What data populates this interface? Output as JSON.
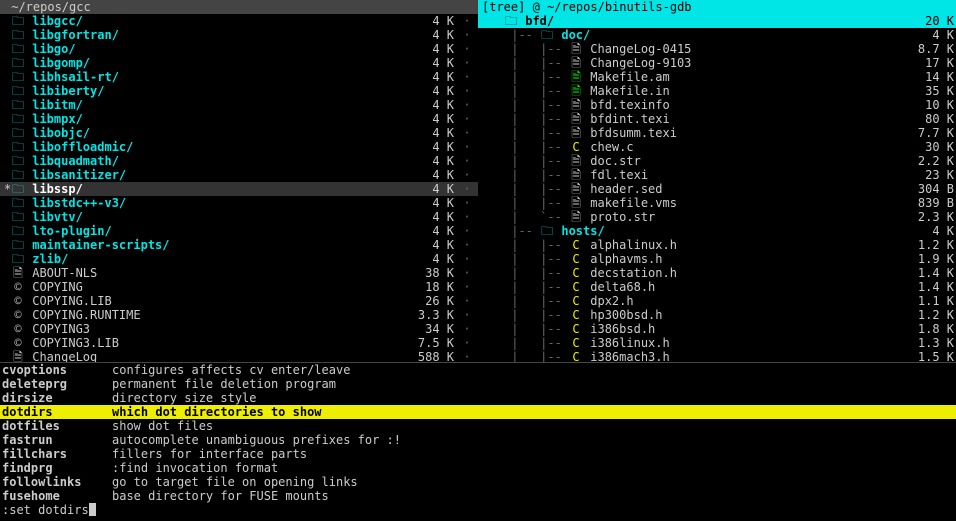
{
  "left": {
    "title": " ~/repos/gcc",
    "items": [
      {
        "icon": "dir",
        "name": "libgcc/",
        "size": "4 K",
        "type": "dir"
      },
      {
        "icon": "dir",
        "name": "libgfortran/",
        "size": "4 K",
        "type": "dir"
      },
      {
        "icon": "dir",
        "name": "libgo/",
        "size": "4 K",
        "type": "dir"
      },
      {
        "icon": "dir",
        "name": "libgomp/",
        "size": "4 K",
        "type": "dir"
      },
      {
        "icon": "dir",
        "name": "libhsail-rt/",
        "size": "4 K",
        "type": "dir"
      },
      {
        "icon": "dir",
        "name": "libiberty/",
        "size": "4 K",
        "type": "dir"
      },
      {
        "icon": "dir",
        "name": "libitm/",
        "size": "4 K",
        "type": "dir"
      },
      {
        "icon": "dir",
        "name": "libmpx/",
        "size": "4 K",
        "type": "dir"
      },
      {
        "icon": "dir",
        "name": "libobjc/",
        "size": "4 K",
        "type": "dir"
      },
      {
        "icon": "dir",
        "name": "liboffloadmic/",
        "size": "4 K",
        "type": "dir"
      },
      {
        "icon": "dir",
        "name": "libquadmath/",
        "size": "4 K",
        "type": "dir"
      },
      {
        "icon": "dir",
        "name": "libsanitizer/",
        "size": "4 K",
        "type": "dir"
      },
      {
        "icon": "dir",
        "name": "libssp/",
        "size": "4 K",
        "type": "dir",
        "sel": true,
        "star": "*"
      },
      {
        "icon": "dir",
        "name": "libstdc++-v3/",
        "size": "4 K",
        "type": "dir"
      },
      {
        "icon": "dir",
        "name": "libvtv/",
        "size": "4 K",
        "type": "dir"
      },
      {
        "icon": "dir",
        "name": "lto-plugin/",
        "size": "4 K",
        "type": "dir"
      },
      {
        "icon": "dir",
        "name": "maintainer-scripts/",
        "size": "4 K",
        "type": "dir"
      },
      {
        "icon": "dir",
        "name": "zlib/",
        "size": "4 K",
        "type": "dir"
      },
      {
        "icon": "txt",
        "name": "ABOUT-NLS",
        "size": "38 K",
        "type": "file"
      },
      {
        "icon": "lic",
        "name": "COPYING",
        "size": "18 K",
        "type": "file"
      },
      {
        "icon": "lic",
        "name": "COPYING.LIB",
        "size": "26 K",
        "type": "file"
      },
      {
        "icon": "lic",
        "name": "COPYING.RUNTIME",
        "size": "3.3 K",
        "type": "file"
      },
      {
        "icon": "lic",
        "name": "COPYING3",
        "size": "34 K",
        "type": "file"
      },
      {
        "icon": "lic",
        "name": "COPYING3.LIB",
        "size": "7.5 K",
        "type": "file"
      },
      {
        "icon": "txt",
        "name": "ChangeLog",
        "size": "588 K",
        "type": "file"
      }
    ]
  },
  "right": {
    "title": "[tree] @ ~/repos/binutils-gdb",
    "items": [
      {
        "tree": "",
        "icon": "dir",
        "name": "bfd/",
        "size": "20 K",
        "type": "dir",
        "hl": true
      },
      {
        "tree": " |-- ",
        "icon": "dir",
        "name": "doc/",
        "size": "4 K",
        "type": "dir"
      },
      {
        "tree": " |   |-- ",
        "icon": "txt",
        "name": "ChangeLog-0415",
        "size": "8.7 K",
        "type": "file"
      },
      {
        "tree": " |   |-- ",
        "icon": "txt",
        "name": "ChangeLog-9103",
        "size": "17 K",
        "type": "file"
      },
      {
        "tree": " |   |-- ",
        "icon": "mk",
        "name": "Makefile.am",
        "size": "14 K",
        "type": "file"
      },
      {
        "tree": " |   |-- ",
        "icon": "mk",
        "name": "Makefile.in",
        "size": "35 K",
        "type": "file"
      },
      {
        "tree": " |   |-- ",
        "icon": "txt",
        "name": "bfd.texinfo",
        "size": "10 K",
        "type": "file"
      },
      {
        "tree": " |   |-- ",
        "icon": "txt",
        "name": "bfdint.texi",
        "size": "80 K",
        "type": "file"
      },
      {
        "tree": " |   |-- ",
        "icon": "txt",
        "name": "bfdsumm.texi",
        "size": "7.7 K",
        "type": "file"
      },
      {
        "tree": " |   |-- ",
        "icon": "c",
        "name": "chew.c",
        "size": "30 K",
        "type": "file"
      },
      {
        "tree": " |   |-- ",
        "icon": "txt",
        "name": "doc.str",
        "size": "2.2 K",
        "type": "file"
      },
      {
        "tree": " |   |-- ",
        "icon": "txt",
        "name": "fdl.texi",
        "size": "23 K",
        "type": "file"
      },
      {
        "tree": " |   |-- ",
        "icon": "txt",
        "name": "header.sed",
        "size": "304 B",
        "type": "file"
      },
      {
        "tree": " |   |-- ",
        "icon": "txt",
        "name": "makefile.vms",
        "size": "839 B",
        "type": "file"
      },
      {
        "tree": " |   `-- ",
        "icon": "txt",
        "name": "proto.str",
        "size": "2.3 K",
        "type": "file"
      },
      {
        "tree": " |-- ",
        "icon": "dir",
        "name": "hosts/",
        "size": "4 K",
        "type": "dir"
      },
      {
        "tree": " |   |-- ",
        "icon": "c",
        "name": "alphalinux.h",
        "size": "1.2 K",
        "type": "file"
      },
      {
        "tree": " |   |-- ",
        "icon": "c",
        "name": "alphavms.h",
        "size": "1.9 K",
        "type": "file"
      },
      {
        "tree": " |   |-- ",
        "icon": "c",
        "name": "decstation.h",
        "size": "1.4 K",
        "type": "file"
      },
      {
        "tree": " |   |-- ",
        "icon": "c",
        "name": "delta68.h",
        "size": "1.4 K",
        "type": "file"
      },
      {
        "tree": " |   |-- ",
        "icon": "c",
        "name": "dpx2.h",
        "size": "1.1 K",
        "type": "file"
      },
      {
        "tree": " |   |-- ",
        "icon": "c",
        "name": "hp300bsd.h",
        "size": "1.2 K",
        "type": "file"
      },
      {
        "tree": " |   |-- ",
        "icon": "c",
        "name": "i386bsd.h",
        "size": "1.8 K",
        "type": "file"
      },
      {
        "tree": " |   |-- ",
        "icon": "c",
        "name": "i386linux.h",
        "size": "1.3 K",
        "type": "file"
      },
      {
        "tree": " |   |-- ",
        "icon": "c",
        "name": "i386mach3.h",
        "size": "1.5 K",
        "type": "file"
      }
    ]
  },
  "options": [
    {
      "k": "cvoptions",
      "d": "configures affects cv enter/leave"
    },
    {
      "k": "deleteprg",
      "d": "permanent file deletion program"
    },
    {
      "k": "dirsize",
      "d": "directory size style"
    },
    {
      "k": "dotdirs",
      "d": "which dot directories to show",
      "sel": true
    },
    {
      "k": "dotfiles",
      "d": "show dot files"
    },
    {
      "k": "fastrun",
      "d": "autocomplete unambiguous prefixes for :!"
    },
    {
      "k": "fillchars",
      "d": "fillers for interface parts"
    },
    {
      "k": "findprg",
      "d": ":find invocation format"
    },
    {
      "k": "followlinks",
      "d": "go to target file on opening links"
    },
    {
      "k": "fusehome",
      "d": "base directory for FUSE mounts"
    }
  ],
  "cmd": ":set dotdirs",
  "iconGlyph": {
    "dir": "🗀",
    "txt": "🗎",
    "lic": "©",
    "mk": "🗎",
    "c": "C"
  },
  "iconClass": {
    "dir": "i-dir",
    "txt": "i-txt",
    "lic": "i-lic",
    "mk": "i-mk",
    "c": "i-c"
  }
}
